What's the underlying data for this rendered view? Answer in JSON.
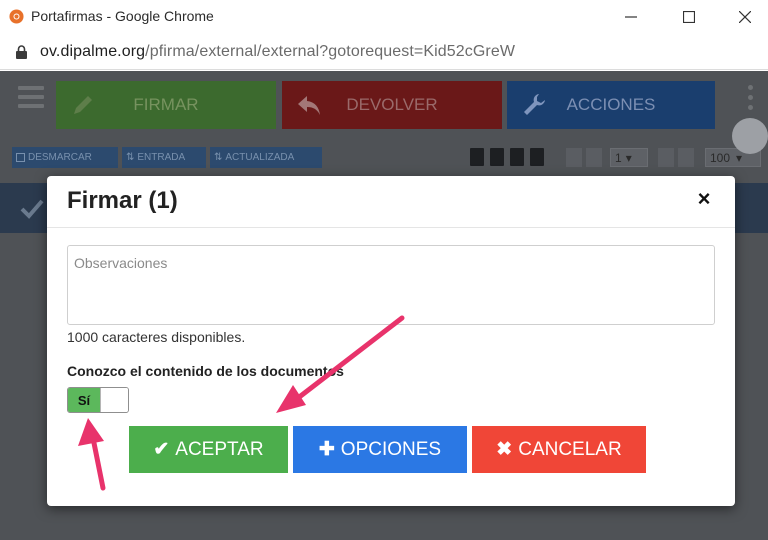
{
  "window": {
    "title": "Portafirmas - Google Chrome",
    "url_domain": "ov.dipalme.org",
    "url_path": "/pfirma/external/external?gotorequest=Kid52cGreW"
  },
  "toolbar": {
    "firmar": "FIRMAR",
    "devolver": "DEVOLVER",
    "acciones": "ACCIONES"
  },
  "subbar": {
    "desmarcar": "DESMARCAR",
    "entrada": "ENTRADA",
    "actualizada": "ACTUALIZADA",
    "page": "1",
    "per_page": "100"
  },
  "modal": {
    "title": "Firmar (1)",
    "observaciones_placeholder": "Observaciones",
    "chars_available": "1000 caracteres disponibles.",
    "conozco_label": "Conozco el contenido de los documentos",
    "toggle_on_label": "Sí",
    "buttons": {
      "aceptar": "ACEPTAR",
      "opciones": "OPCIONES",
      "cancelar": "CANCELAR"
    }
  },
  "colors": {
    "aceptar": "#4cae4c",
    "opciones": "#2b78e4",
    "cancelar": "#f04637",
    "arrow": "#e8336b"
  },
  "icons": {
    "close": "×",
    "check": "✔",
    "plus": "✚",
    "cross": "✖",
    "caret": "▾"
  }
}
